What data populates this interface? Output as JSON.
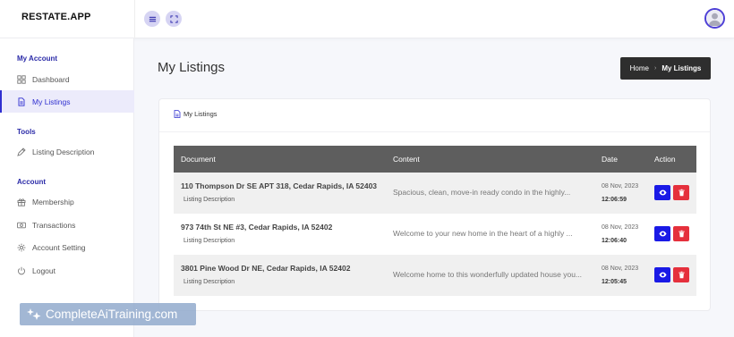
{
  "app": {
    "logo": "RESTATE.APP"
  },
  "topbar": {
    "menu_icon": "menu-icon",
    "expand_icon": "fullscreen-icon",
    "avatar": "user-avatar"
  },
  "sidebar": {
    "sections": [
      {
        "label": "My Account"
      },
      {
        "label": "Tools"
      },
      {
        "label": "Account"
      }
    ],
    "items": [
      {
        "label": "Dashboard",
        "icon": "grid-icon"
      },
      {
        "label": "My Listings",
        "icon": "document-icon",
        "active": true
      },
      {
        "label": "Listing Description",
        "icon": "pen-icon"
      },
      {
        "label": "Membership",
        "icon": "gift-icon"
      },
      {
        "label": "Transactions",
        "icon": "money-icon"
      },
      {
        "label": "Account Setting",
        "icon": "gear-icon"
      },
      {
        "label": "Logout",
        "icon": "power-icon"
      }
    ]
  },
  "page": {
    "title": "My Listings"
  },
  "breadcrumb": {
    "home": "Home",
    "separator": "›",
    "current": "My Listings"
  },
  "card": {
    "title": "My Listings"
  },
  "table": {
    "headers": [
      "Document",
      "Content",
      "Date",
      "Action"
    ],
    "rows": [
      {
        "address": "110 Thompson Dr SE APT 318, Cedar Rapids, IA 52403",
        "type": "Listing Description",
        "content": "Spacious, clean, move-in ready condo in the highly...",
        "date": "08 Nov, 2023",
        "time": "12:06:59"
      },
      {
        "address": "973 74th St NE #3, Cedar Rapids, IA 52402",
        "type": "Listing Description",
        "content": "Welcome to your new home in the heart of a highly ...",
        "date": "08 Nov, 2023",
        "time": "12:06:40"
      },
      {
        "address": "3801 Pine Wood Dr NE, Cedar Rapids, IA 52402",
        "type": "Listing Description",
        "content": "Welcome home to this wonderfully updated house you...",
        "date": "08 Nov, 2023",
        "time": "12:05:45"
      }
    ]
  },
  "watermark": {
    "text": "CompleteAiTraining.com"
  },
  "colors": {
    "accent": "#2f2fd0",
    "view_button": "#1a1ae6",
    "delete_button": "#e5303c",
    "table_header": "#5e5e5e",
    "breadcrumb_bg": "#2e2e2e"
  }
}
